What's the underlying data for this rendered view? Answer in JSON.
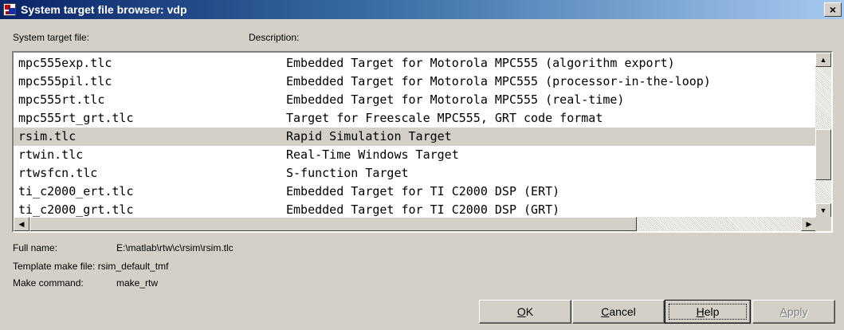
{
  "window": {
    "title": "System target file browser: vdp",
    "close_glyph": "×"
  },
  "columns": {
    "file": "System target file:",
    "description": "Description:"
  },
  "list": {
    "rows": [
      {
        "file": "mpc555exp.tlc",
        "description": "Embedded Target for Motorola MPC555 (algorithm export)",
        "selected": false
      },
      {
        "file": "mpc555pil.tlc",
        "description": "Embedded Target for Motorola MPC555 (processor-in-the-loop)",
        "selected": false
      },
      {
        "file": "mpc555rt.tlc",
        "description": "Embedded Target for Motorola MPC555 (real-time)",
        "selected": false
      },
      {
        "file": "mpc555rt_grt.tlc",
        "description": "Target for Freescale MPC555, GRT code format",
        "selected": false
      },
      {
        "file": "rsim.tlc",
        "description": "Rapid Simulation Target",
        "selected": true
      },
      {
        "file": "rtwin.tlc",
        "description": "Real-Time Windows Target",
        "selected": false
      },
      {
        "file": "rtwsfcn.tlc",
        "description": "S-function Target",
        "selected": false
      },
      {
        "file": "ti_c2000_ert.tlc",
        "description": "Embedded Target for TI C2000 DSP (ERT)",
        "selected": false
      },
      {
        "file": "ti_c2000_grt.tlc",
        "description": "Embedded Target for TI C2000 DSP (GRT)",
        "selected": false
      }
    ],
    "scroll_glyphs": {
      "up": "▲",
      "down": "▼",
      "left": "◀",
      "right": "▶"
    }
  },
  "details": {
    "full_name_label": "Full name:",
    "full_name_value": "E:\\matlab\\rtw\\c\\rsim\\rsim.tlc",
    "template_label": "Template make file:",
    "template_value": "rsim_default_tmf",
    "make_label": "Make command:",
    "make_value": "make_rtw"
  },
  "buttons": {
    "ok": {
      "mnemonic": "O",
      "rest": "K"
    },
    "cancel": {
      "mnemonic": "C",
      "rest": "ancel"
    },
    "help": {
      "mnemonic": "H",
      "rest": "elp"
    },
    "apply": {
      "mnemonic": "A",
      "rest": "pply"
    }
  },
  "colors": {
    "titlebar_start": "#0a246a",
    "titlebar_end": "#a6caf0",
    "dialog_face": "#d4d0c8",
    "selected_row": "#d4d0c8"
  }
}
